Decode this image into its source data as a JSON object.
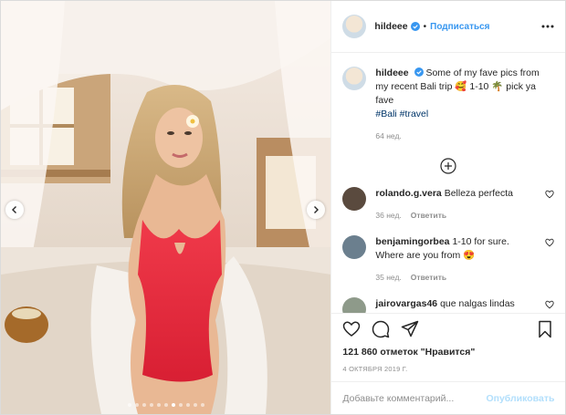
{
  "post": {
    "author": "hildeee",
    "follow_label": "Подписаться",
    "separator": "•",
    "photo": {
      "slide_count": 11,
      "active_slide": 6
    }
  },
  "caption": {
    "username": "hildeee",
    "text_line": "Some of my fave pics from my recent Bali trip 🥰 1-10 🌴 pick ya fave",
    "hashtags": "#Bali #travel",
    "time": "64 нед."
  },
  "comments": [
    {
      "username": "rolando.g.vera",
      "text": "Belleza perfecta",
      "time": "36 нед.",
      "reply_label": "Ответить",
      "avatar_color": "#5a4a3e"
    },
    {
      "username": "benjamingorbea",
      "text": "1-10 for sure. Where are you from 😍",
      "time": "35 нед.",
      "reply_label": "Ответить",
      "avatar_color": "#6b7f8e"
    },
    {
      "username": "jairovargas46",
      "text": "que nalgas lindas",
      "time": "",
      "reply_label": "",
      "avatar_color": "#8e9a8a"
    }
  ],
  "actions": {
    "likes_count": "121 860",
    "likes_word": "отметок",
    "likes_link": "\"Нравится\"",
    "date": "4 ОКТЯБРЯ 2019 Г."
  },
  "comment_box": {
    "placeholder": "Добавьте комментарий...",
    "publish_label": "Опубликовать"
  },
  "colors": {
    "accent_blue": "#3897f0",
    "verified_blue": "#3897f0",
    "muted_gray": "#8e8e8e",
    "publish_disabled": "#b2dffc"
  },
  "icons": [
    "chevron-left-icon",
    "chevron-right-icon",
    "verified-badge-icon",
    "more-options-icon",
    "heart-icon",
    "comment-icon",
    "share-icon",
    "bookmark-icon",
    "plus-circle-icon"
  ]
}
